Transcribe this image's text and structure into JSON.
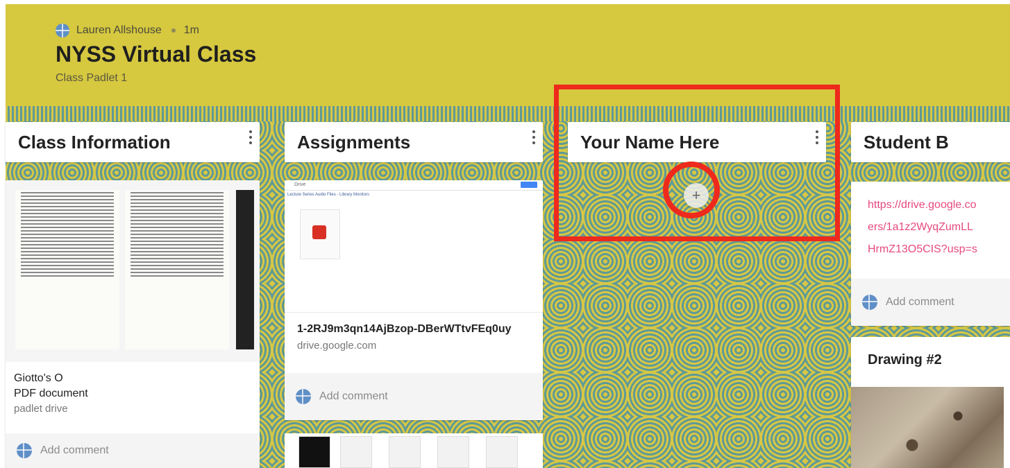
{
  "header": {
    "author": "Lauren Allshouse",
    "time": "1m",
    "title": "NYSS Virtual Class",
    "subtitle": "Class Padlet 1"
  },
  "columns": [
    {
      "label": "Class Information"
    },
    {
      "label": "Assignments"
    },
    {
      "label": "Your Name Here"
    },
    {
      "label": "Student B"
    }
  ],
  "cards": {
    "class_info": {
      "name": "Giotto's O",
      "type": "PDF document",
      "source": "padlet drive",
      "comment_placeholder": "Add comment"
    },
    "assignment": {
      "drive_app": "Drive",
      "drive_folder": "Lecture Series Audio Files - Library Monitors",
      "title": "1-2RJ9m3qn14AjBzop-DBerWTtvFEq0uy",
      "url": "drive.google.com",
      "comment_placeholder": "Add comment"
    },
    "student_b": {
      "url_line1": "https://drive.google.co",
      "url_line2": "ers/1a1z2WyqZumLL",
      "url_line3": "HrmZ13O5CIS?usp=s",
      "comment_placeholder": "Add comment"
    },
    "drawing": {
      "title": "Drawing #2"
    }
  },
  "add_button": {
    "symbol": "+"
  },
  "colors": {
    "header_bg": "#d6c83f",
    "highlight_red": "#ee2a1c",
    "link_pink": "#e64980"
  }
}
